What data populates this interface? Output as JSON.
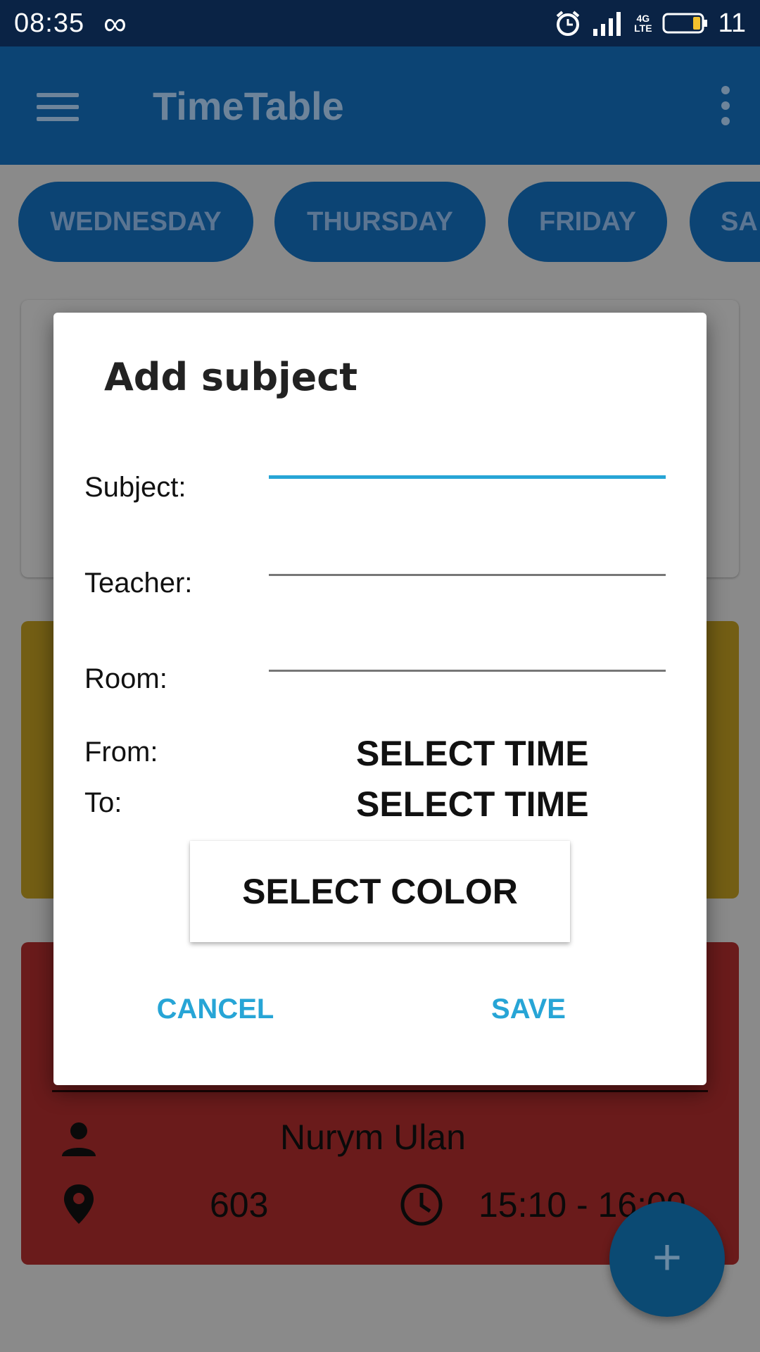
{
  "status_bar": {
    "time": "08:35",
    "battery_level": "11",
    "network": "4G",
    "network_sub": "LTE"
  },
  "app_bar": {
    "title": "TimeTable"
  },
  "days": [
    "WEDNESDAY",
    "THURSDAY",
    "FRIDAY",
    "SA"
  ],
  "background_card": {
    "teacher": "Nurym Ulan",
    "room": "603",
    "time": "15:10 - 16:00"
  },
  "dialog": {
    "title": "Add subject",
    "subject_label": "Subject:",
    "teacher_label": "Teacher:",
    "room_label": "Room:",
    "from_label": "From:",
    "to_label": "To:",
    "from_button": "SELECT TIME",
    "to_button": "SELECT TIME",
    "color_button": "SELECT COLOR",
    "cancel": "CANCEL",
    "save": "SAVE"
  },
  "fab_label": "+",
  "colors": {
    "accent": "#27a5d6",
    "app_bar": "#0c4474",
    "status_bar": "#0a2345"
  }
}
